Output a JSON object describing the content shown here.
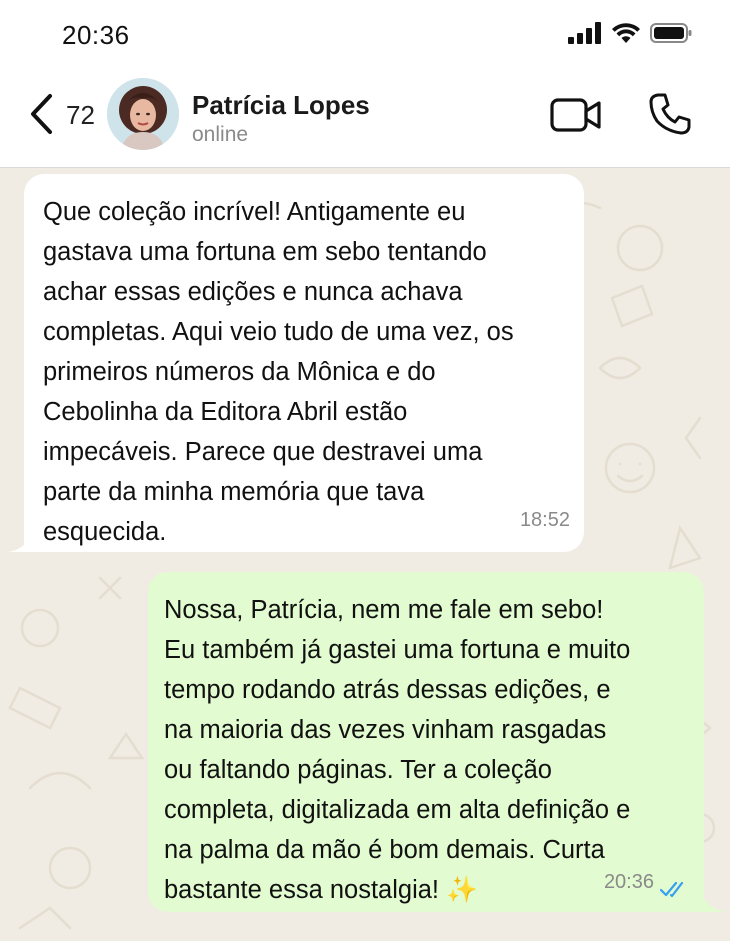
{
  "status_bar": {
    "time": "20:36",
    "icons": [
      "signal-icon",
      "wifi-icon",
      "battery-icon"
    ]
  },
  "header": {
    "back_count": "72",
    "contact_name": "Patrícia Lopes",
    "contact_status": "online",
    "icons": [
      "back-chevron-icon",
      "video-camera-icon",
      "phone-icon"
    ]
  },
  "messages": [
    {
      "direction": "incoming",
      "lines": [
        "Que coleção incrível! Antigamente eu",
        "gastava uma fortuna em sebo tentando",
        "achar essas edições e nunca achava",
        "completas. Aqui veio tudo de uma vez, os",
        "primeiros números da Mônica e do",
        "Cebolinha da Editora Abril estão",
        "impecáveis. Parece que destravei uma",
        "parte da minha memória que tava",
        "esquecida."
      ],
      "time": "18:52"
    },
    {
      "direction": "outgoing",
      "lines": [
        "Nossa, Patrícia, nem me fale em sebo!",
        "Eu também já gastei uma fortuna e muito",
        "tempo rodando atrás dessas edições, e",
        "na maioria das vezes vinham rasgadas",
        "ou faltando páginas. Ter a coleção",
        "completa, digitalizada em alta definição e",
        "na palma da mão é bom demais. Curta",
        "bastante essa nostalgia! ✨"
      ],
      "time": "20:36",
      "status": "read"
    }
  ],
  "colors": {
    "chat_background": "#f0ece3",
    "incoming_bubble": "#ffffff",
    "outgoing_bubble": "#e2fbd0",
    "read_ticks": "#34a0f0"
  }
}
